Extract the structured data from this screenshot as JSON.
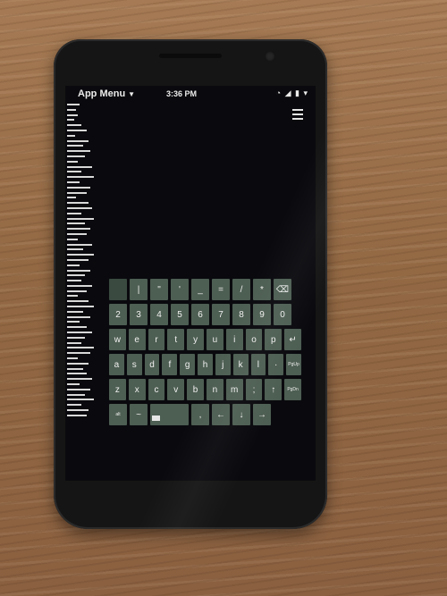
{
  "status_bar": {
    "app_menu_label": "App Menu",
    "time": "3:36 PM",
    "icons": [
      "wifi-icon",
      "signal-icon",
      "battery-icon"
    ]
  },
  "toolbar": {
    "menu_icon": "hamburger-icon"
  },
  "keyboard": {
    "rows": [
      [
        {
          "label": "",
          "icon": "tab-icon"
        },
        {
          "label": "|"
        },
        {
          "label": "\""
        },
        {
          "label": "'"
        },
        {
          "label": "_"
        },
        {
          "label": "="
        },
        {
          "label": "/"
        },
        {
          "label": "*"
        },
        {
          "label": "⌫",
          "icon": "backspace-icon"
        }
      ],
      [
        {
          "label": "2"
        },
        {
          "label": "3"
        },
        {
          "label": "4"
        },
        {
          "label": "5"
        },
        {
          "label": "6"
        },
        {
          "label": "7"
        },
        {
          "label": "8"
        },
        {
          "label": "9"
        },
        {
          "label": "0"
        }
      ],
      [
        {
          "label": "w"
        },
        {
          "label": "e"
        },
        {
          "label": "r"
        },
        {
          "label": "t"
        },
        {
          "label": "y"
        },
        {
          "label": "u"
        },
        {
          "label": "i"
        },
        {
          "label": "o"
        },
        {
          "label": "p"
        },
        {
          "label": "↵",
          "icon": "enter-icon"
        }
      ],
      [
        {
          "label": "a"
        },
        {
          "label": "s"
        },
        {
          "label": "d"
        },
        {
          "label": "f"
        },
        {
          "label": "g"
        },
        {
          "label": "h"
        },
        {
          "label": "j"
        },
        {
          "label": "k"
        },
        {
          "label": "l"
        },
        {
          "label": "·"
        },
        {
          "label": "PgUp"
        }
      ],
      [
        {
          "label": "z"
        },
        {
          "label": "x"
        },
        {
          "label": "c"
        },
        {
          "label": "v"
        },
        {
          "label": "b"
        },
        {
          "label": "n"
        },
        {
          "label": "m"
        },
        {
          "label": ";"
        },
        {
          "label": "↑",
          "icon": "arrow-up-icon"
        },
        {
          "label": "PgDn"
        }
      ],
      [
        {
          "label": "alt"
        },
        {
          "label": "~"
        },
        {
          "label": "",
          "icon": "space-key"
        },
        {
          "label": ","
        },
        {
          "label": "←",
          "icon": "arrow-left-icon"
        },
        {
          "label": "↓",
          "icon": "arrow-down-icon"
        },
        {
          "label": "→",
          "icon": "arrow-right-icon"
        }
      ]
    ]
  }
}
